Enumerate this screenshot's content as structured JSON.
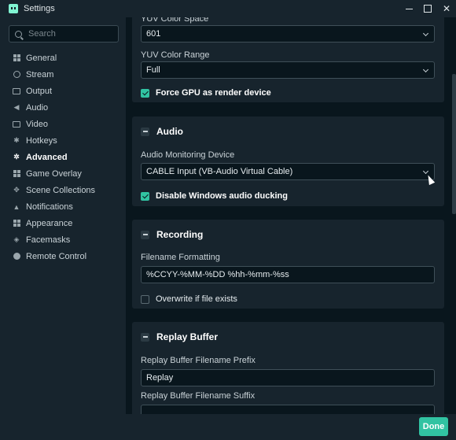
{
  "window": {
    "title": "Settings"
  },
  "sidebar": {
    "search_placeholder": "Search",
    "items": [
      {
        "label": "General",
        "icon": "grid-icon"
      },
      {
        "label": "Stream",
        "icon": "globe-icon"
      },
      {
        "label": "Output",
        "icon": "output-icon"
      },
      {
        "label": "Audio",
        "icon": "speaker-icon"
      },
      {
        "label": "Video",
        "icon": "film-icon"
      },
      {
        "label": "Hotkeys",
        "icon": "gear-icon"
      },
      {
        "label": "Advanced",
        "icon": "gears-icon",
        "active": true
      },
      {
        "label": "Game Overlay",
        "icon": "overlay-icon"
      },
      {
        "label": "Scene Collections",
        "icon": "collections-icon"
      },
      {
        "label": "Notifications",
        "icon": "bell-icon"
      },
      {
        "label": "Appearance",
        "icon": "appearance-icon"
      },
      {
        "label": "Facemasks",
        "icon": "mask-icon"
      },
      {
        "label": "Remote Control",
        "icon": "play-circle-icon"
      }
    ]
  },
  "video_section": {
    "yuv_color_space_label": "YUV Color Space",
    "yuv_color_space_value": "601",
    "yuv_color_range_label": "YUV Color Range",
    "yuv_color_range_value": "Full",
    "force_gpu_label": "Force GPU as render device",
    "force_gpu_checked": true
  },
  "audio_section": {
    "title": "Audio",
    "monitoring_device_label": "Audio Monitoring Device",
    "monitoring_device_value": "CABLE Input (VB-Audio Virtual Cable)",
    "disable_ducking_label": "Disable Windows audio ducking",
    "disable_ducking_checked": true
  },
  "recording_section": {
    "title": "Recording",
    "filename_formatting_label": "Filename Formatting",
    "filename_formatting_value": "%CCYY-%MM-%DD %hh-%mm-%ss",
    "overwrite_label": "Overwrite if file exists",
    "overwrite_checked": false
  },
  "replay_section": {
    "title": "Replay Buffer",
    "prefix_label": "Replay Buffer Filename Prefix",
    "prefix_value": "Replay",
    "suffix_label": "Replay Buffer Filename Suffix",
    "suffix_value": ""
  },
  "footer": {
    "done_label": "Done"
  },
  "colors": {
    "accent": "#31c3a2",
    "background": "#09161d",
    "panel": "#17242d"
  }
}
